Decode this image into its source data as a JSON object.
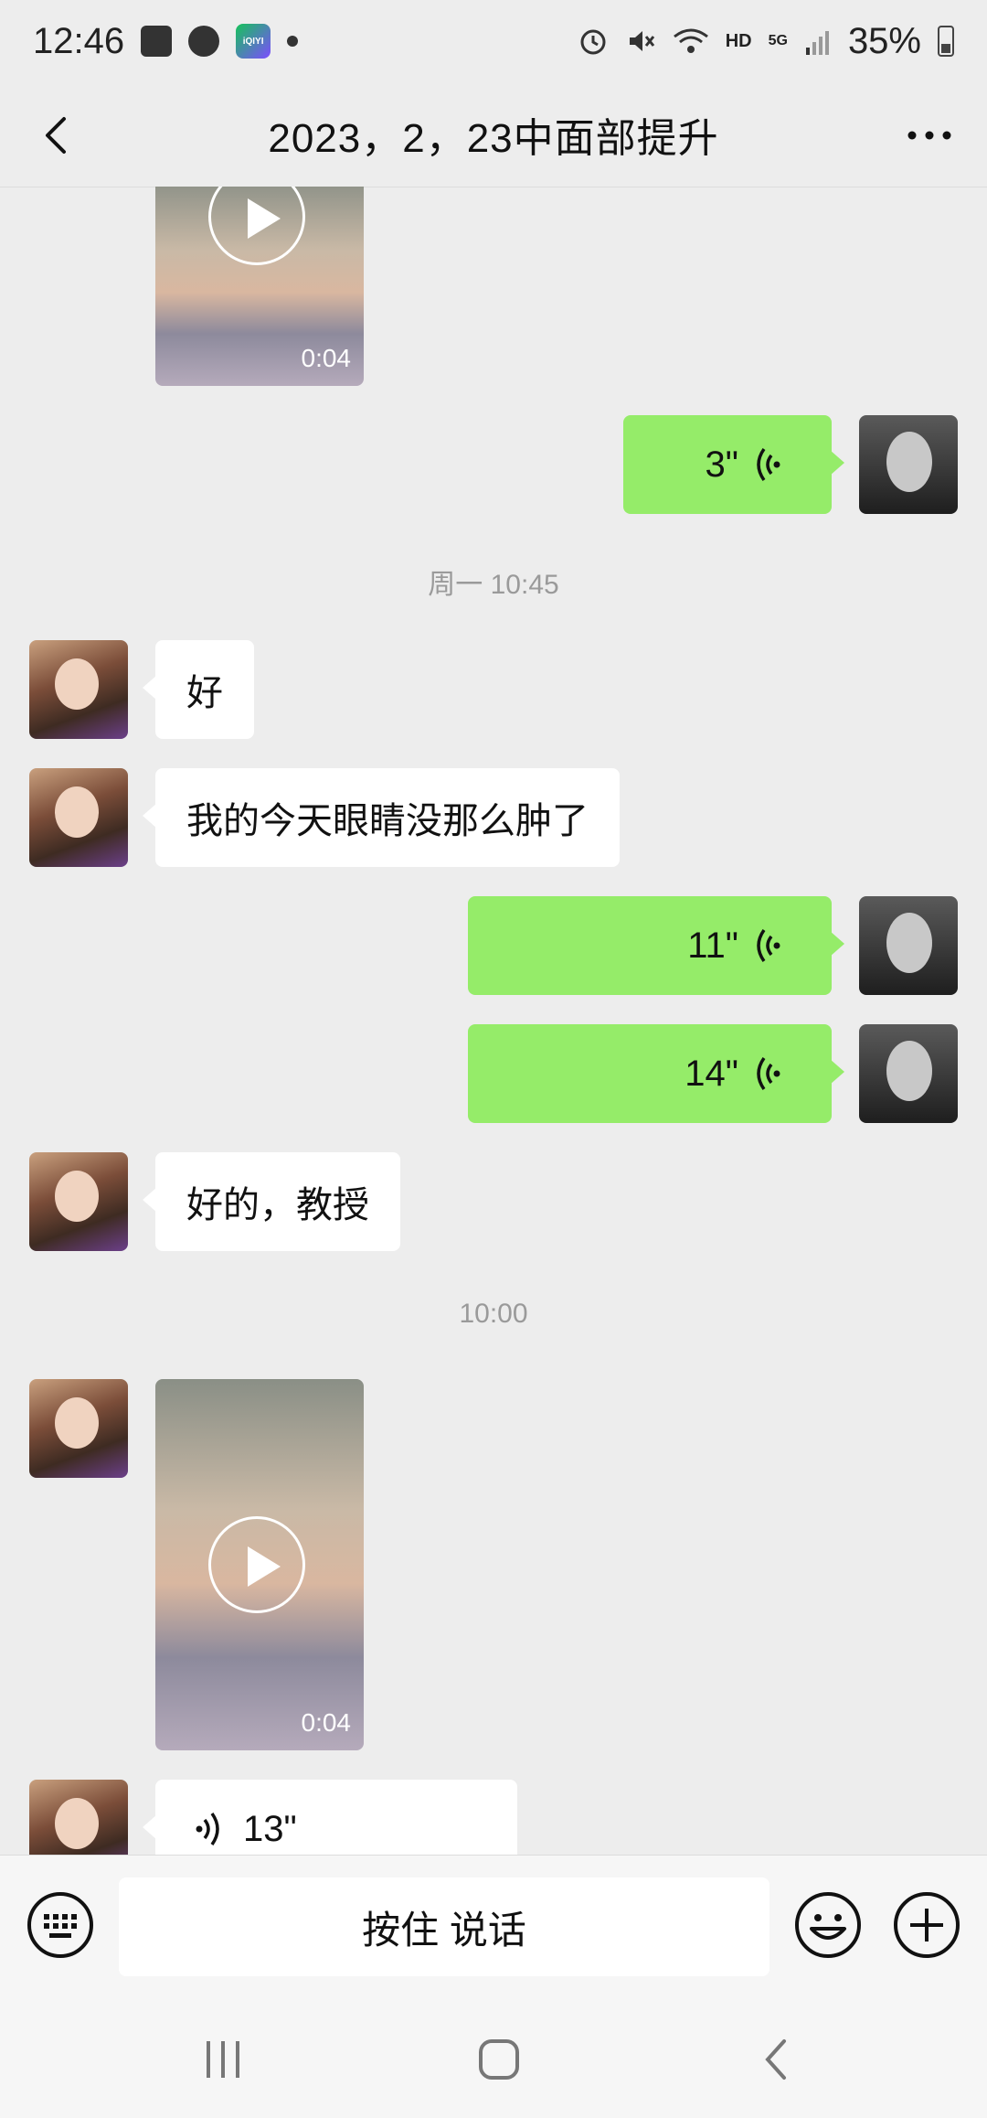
{
  "status_bar": {
    "time": "12:46",
    "battery": "35%",
    "hd": "HD",
    "network": "5G"
  },
  "header": {
    "title": "2023，2，23中面部提升"
  },
  "messages": {
    "video_top": {
      "duration": "0:04"
    },
    "voice_out_1": {
      "length": "3\""
    },
    "time_1": "周一 10:45",
    "text_in_1": "好",
    "text_in_2": "我的今天眼睛没那么肿了",
    "voice_out_2": {
      "length": "11\""
    },
    "voice_out_3": {
      "length": "14\""
    },
    "text_in_3": "好的，教授",
    "time_2": "10:00",
    "video_in": {
      "duration": "0:04"
    },
    "voice_in_1": {
      "length": "13\""
    }
  },
  "input_bar": {
    "hold_to_talk": "按住 说话"
  },
  "icons": {
    "back": "chevron-left-icon",
    "more": "more-dots-icon",
    "keyboard": "keyboard-icon",
    "emoji": "emoji-icon",
    "plus": "plus-icon",
    "voice": "voice-wave-icon"
  },
  "colors": {
    "bubble_out": "#95ec69",
    "bubble_in": "#ffffff",
    "background": "#ededed"
  }
}
